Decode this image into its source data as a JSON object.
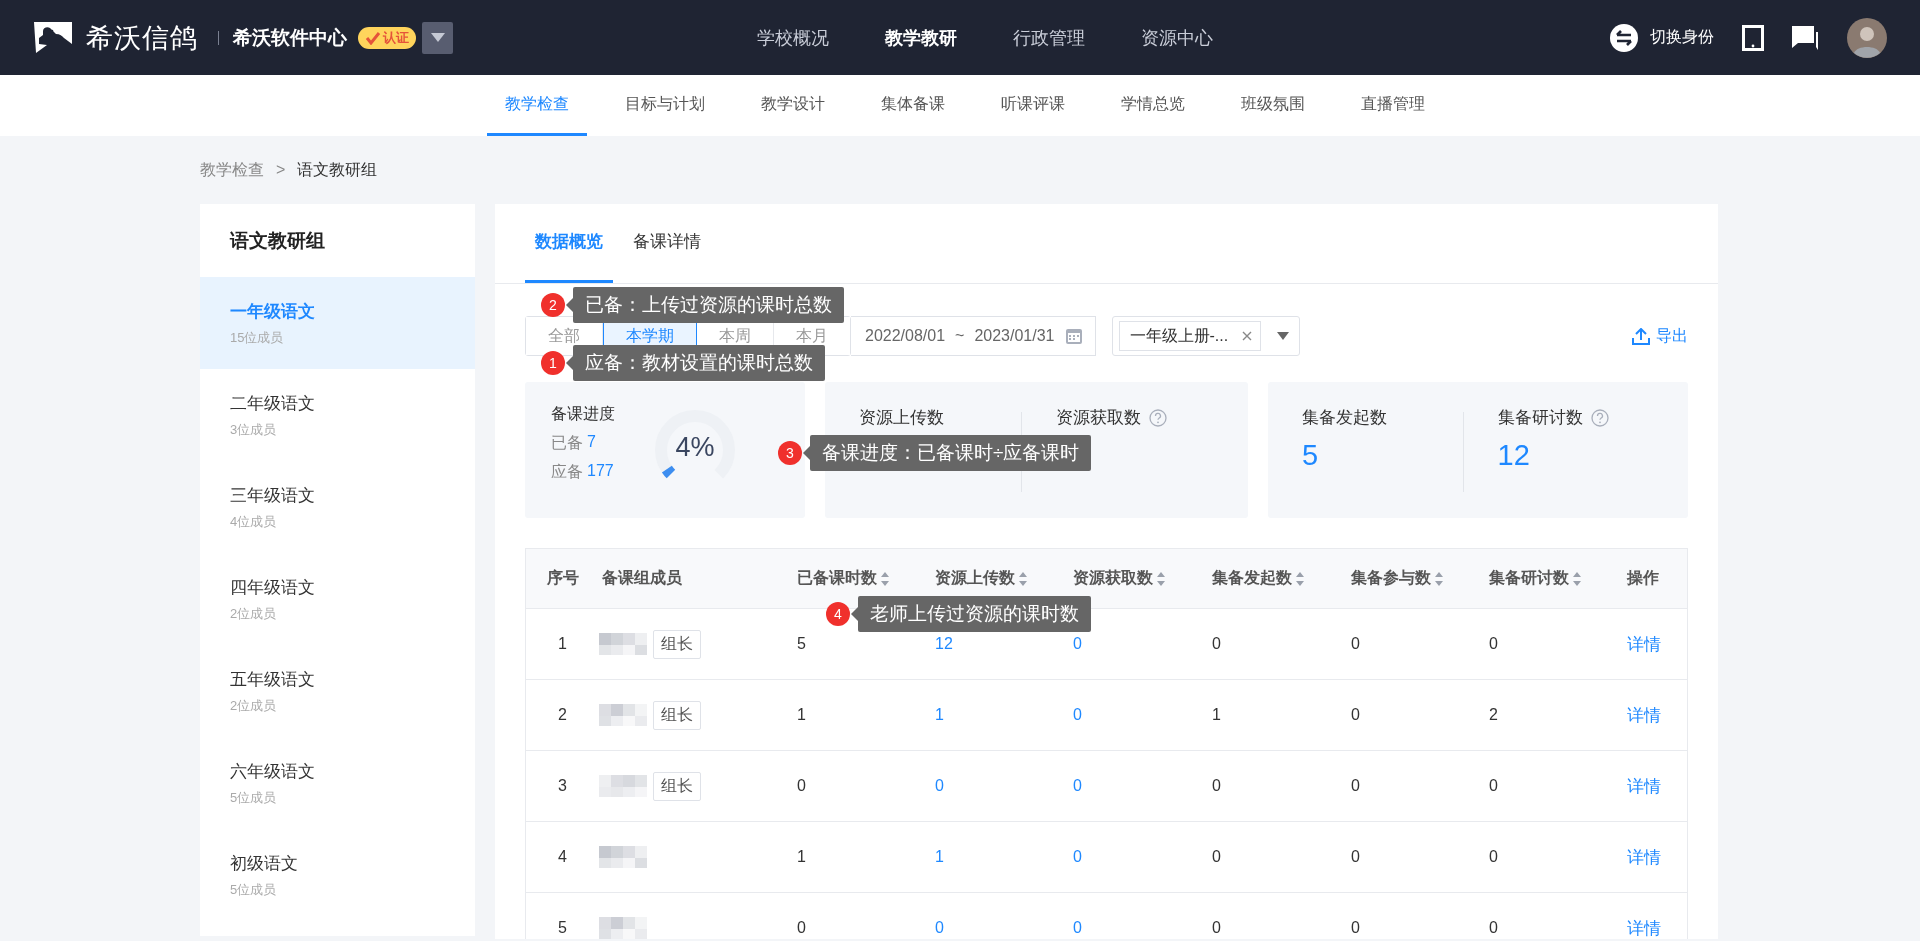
{
  "header": {
    "logo_text": "希沃信鸽",
    "org": "希沃软件中心",
    "badge": "认证",
    "nav": [
      {
        "label": "学校概况",
        "selected": false
      },
      {
        "label": "教学教研",
        "selected": true
      },
      {
        "label": "行政管理",
        "selected": false
      },
      {
        "label": "资源中心",
        "selected": false
      }
    ],
    "switch_identity": "切换身份"
  },
  "subnav": [
    {
      "label": "教学检查",
      "selected": true
    },
    {
      "label": "目标与计划",
      "selected": false
    },
    {
      "label": "教学设计",
      "selected": false
    },
    {
      "label": "集体备课",
      "selected": false
    },
    {
      "label": "听课评课",
      "selected": false
    },
    {
      "label": "学情总览",
      "selected": false
    },
    {
      "label": "班级氛围",
      "selected": false
    },
    {
      "label": "直播管理",
      "selected": false
    }
  ],
  "breadcrumb": {
    "items": [
      "教学检查",
      "语文教研组"
    ],
    "separator": ">"
  },
  "sidebar": {
    "title": "语文教研组",
    "groups": [
      {
        "name": "一年级语文",
        "members": "15位成员",
        "selected": true
      },
      {
        "name": "二年级语文",
        "members": "3位成员",
        "selected": false
      },
      {
        "name": "三年级语文",
        "members": "4位成员",
        "selected": false
      },
      {
        "name": "四年级语文",
        "members": "2位成员",
        "selected": false
      },
      {
        "name": "五年级语文",
        "members": "2位成员",
        "selected": false
      },
      {
        "name": "六年级语文",
        "members": "5位成员",
        "selected": false
      },
      {
        "name": "初级语文",
        "members": "5位成员",
        "selected": false
      }
    ]
  },
  "tabs": [
    {
      "label": "数据概览",
      "selected": true
    },
    {
      "label": "备课详情",
      "selected": false
    }
  ],
  "filters": {
    "ranges": [
      {
        "label": "全部",
        "selected": false
      },
      {
        "label": "本学期",
        "selected": true
      },
      {
        "label": "本周",
        "selected": false
      },
      {
        "label": "本月",
        "selected": false
      }
    ],
    "date_start": "2022/08/01",
    "date_sep": "~",
    "date_end": "2023/01/31",
    "select_value": "一年级上册-...",
    "export": "导出"
  },
  "progress": {
    "title": "备课进度",
    "prepared_label": "已备",
    "prepared": "7",
    "required_label": "应备",
    "required": "177",
    "percent": "4%",
    "level": 0.04
  },
  "stat_groups": [
    [
      {
        "label": "资源上传数",
        "help": false
      },
      {
        "label": "资源获取数",
        "help": true
      }
    ],
    [
      {
        "label": "集备发起数",
        "value": "5",
        "help": false
      },
      {
        "label": "集备研讨数",
        "value": "12",
        "help": true
      }
    ]
  ],
  "table": {
    "columns": [
      {
        "label": "序号",
        "sortable": false
      },
      {
        "label": "备课组成员",
        "sortable": false
      },
      {
        "label": "已备课时数",
        "sortable": true
      },
      {
        "label": "资源上传数",
        "sortable": true
      },
      {
        "label": "资源获取数",
        "sortable": true
      },
      {
        "label": "集备发起数",
        "sortable": true
      },
      {
        "label": "集备参与数",
        "sortable": true
      },
      {
        "label": "集备研讨数",
        "sortable": true
      },
      {
        "label": "操作",
        "sortable": false
      }
    ],
    "rows": [
      {
        "index": "1",
        "tag": "组长",
        "prepared": "5",
        "uploads": "12",
        "fetched": "0",
        "launched": "0",
        "joined": "0",
        "discussed": "0",
        "action": "详情"
      },
      {
        "index": "2",
        "tag": "组长",
        "prepared": "1",
        "uploads": "1",
        "fetched": "0",
        "launched": "1",
        "joined": "0",
        "discussed": "2",
        "action": "详情"
      },
      {
        "index": "3",
        "tag": "组长",
        "prepared": "0",
        "uploads": "0",
        "fetched": "0",
        "launched": "0",
        "joined": "0",
        "discussed": "0",
        "action": "详情"
      },
      {
        "index": "4",
        "prepared": "1",
        "uploads": "1",
        "fetched": "0",
        "launched": "0",
        "joined": "0",
        "discussed": "0",
        "action": "详情"
      },
      {
        "index": "5",
        "prepared": "0",
        "uploads": "0",
        "fetched": "0",
        "launched": "0",
        "joined": "0",
        "discussed": "0",
        "action": "详情"
      }
    ]
  },
  "tooltips": [
    {
      "number": "2",
      "text": "已备：上传过资源的课时总数"
    },
    {
      "number": "1",
      "text": "应备：教材设置的课时总数"
    },
    {
      "number": "3",
      "text": "备课进度：已备课时÷应备课时"
    },
    {
      "number": "4",
      "text": "老师上传过资源的课时数"
    }
  ]
}
